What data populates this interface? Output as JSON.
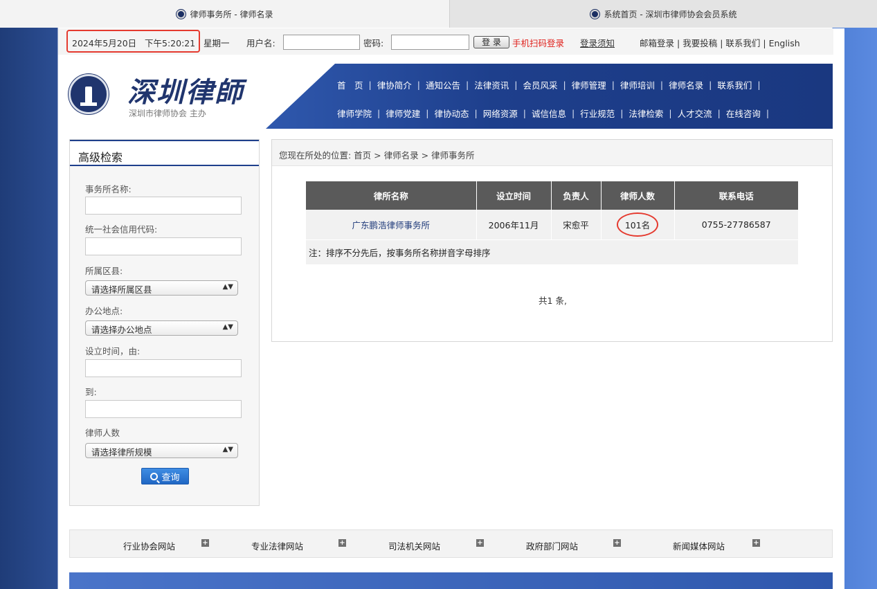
{
  "browser": {
    "tabs": [
      {
        "title": "律师事务所 - 律师名录"
      },
      {
        "title": "系统首页 - 深圳市律师协会会员系统"
      }
    ]
  },
  "topbar": {
    "date": "2024年5月20日",
    "time": "下午5:20:21",
    "weekday": "星期一",
    "username_label": "用户名:",
    "password_label": "密码:",
    "login_button": "登 录",
    "qr_login": "手机扫码登录",
    "login_notice": "登录须知",
    "links": [
      "邮箱登录",
      "我要投稿",
      "联系我们",
      "English"
    ]
  },
  "header": {
    "logo_title": "深圳律師",
    "logo_sub": "深圳市律师协会 主办",
    "nav_row1": [
      "首　页",
      "律协简介",
      "通知公告",
      "法律资讯",
      "会员风采",
      "律师管理",
      "律师培训",
      "律师名录",
      "联系我们"
    ],
    "nav_row2": [
      "律师学院",
      "律师党建",
      "律协动态",
      "网络资源",
      "诚信信息",
      "行业规范",
      "法律检索",
      "人才交流",
      "在线咨询"
    ]
  },
  "sidebar": {
    "title": "高级检索",
    "firm_name_label": "事务所名称:",
    "credit_code_label": "统一社会信用代码:",
    "district_label": "所属区县:",
    "district_select": "请选择所属区县",
    "office_label": "办公地点:",
    "office_select": "请选择办公地点",
    "established_from_label": "设立时间，由:",
    "established_to_label": "到:",
    "lawyer_count_label": "律师人数",
    "size_select": "请选择律所规模",
    "search_button": "查询"
  },
  "main": {
    "breadcrumb": "您现在所处的位置:  首页 > 律师名录 > 律师事务所",
    "table": {
      "headers": [
        "律所名称",
        "设立时间",
        "负责人",
        "律师人数",
        "联系电话"
      ],
      "rows": [
        {
          "name": "广东鹏浩律师事务所",
          "established": "2006年11月",
          "principal": "宋愈平",
          "lawyers": "101名",
          "phone": "0755-27786587"
        }
      ],
      "note": "注：排序不分先后，按事务所名称拼音字母排序"
    },
    "total": "共1 条,"
  },
  "footer": {
    "links": [
      "行业协会网站",
      "专业法律网站",
      "司法机关网站",
      "政府部门网站",
      "新闻媒体网站"
    ]
  },
  "colors": {
    "brand_blue": "#1e3f8c",
    "highlight_red": "#e53a2f",
    "table_header": "#5a5a5a"
  }
}
